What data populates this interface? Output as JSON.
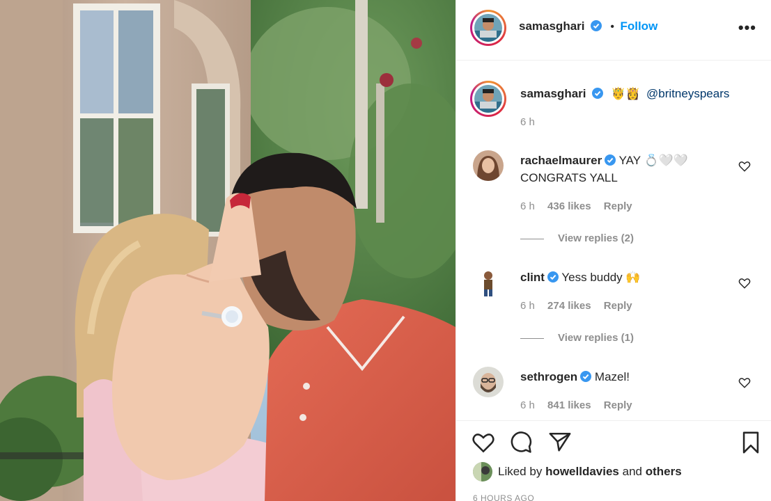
{
  "post": {
    "author": "samasghari",
    "follow_label": "Follow",
    "separator": "•",
    "more_label": "•••"
  },
  "caption": {
    "author": "samasghari",
    "emojis": "🤴👸",
    "mention": "@britneyspears",
    "time": "6 h"
  },
  "comments": [
    {
      "author": "rachaelmaurer",
      "text_line1": "YAY 💍🤍🤍",
      "text_line2": "CONGRATS YALL",
      "time": "6 h",
      "likes": "436 likes",
      "reply_label": "Reply",
      "view_replies": "View replies (2)"
    },
    {
      "author": "clint",
      "text_line1": "Yess buddy 🙌",
      "time": "6 h",
      "likes": "274 likes",
      "reply_label": "Reply",
      "view_replies": "View replies (1)"
    },
    {
      "author": "sethrogen",
      "text_line1": "Mazel!",
      "time": "6 h",
      "likes": "841 likes",
      "reply_label": "Reply"
    }
  ],
  "likes": {
    "prefix": "Liked by",
    "user": "howelldavies",
    "conjunction": "and",
    "suffix": "others"
  },
  "timestamp": "6 HOURS AGO",
  "icons": {
    "verified": "verified-badge-icon",
    "like": "heart-icon",
    "comment": "comment-icon",
    "share": "paper-plane-icon",
    "save": "bookmark-icon"
  },
  "colors": {
    "follow": "#0095f6",
    "verified": "#3897f0",
    "muted": "#8e8e8e",
    "text": "#262626"
  }
}
